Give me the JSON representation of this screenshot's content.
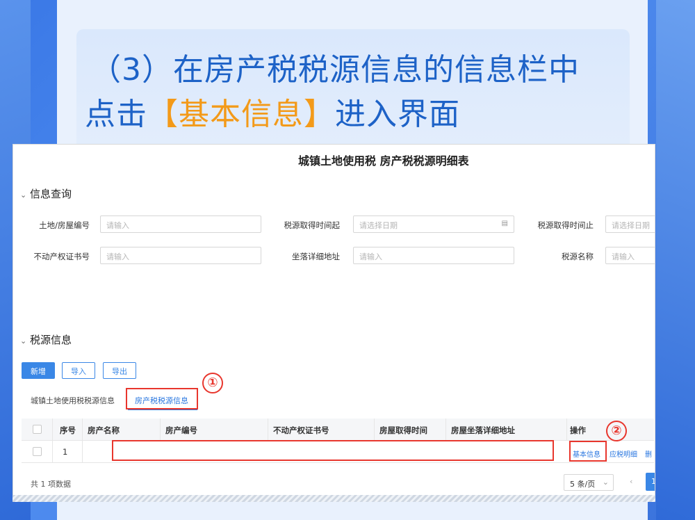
{
  "heading": {
    "line1": "（3）在房产税税源信息的信息栏中",
    "line2_pre": "点击",
    "line2_highlight": "【基本信息】",
    "line2_post": "进入界面"
  },
  "screenshot": {
    "title": "城镇土地使用税 房产税税源明细表",
    "query_section": {
      "title": "信息查询",
      "fields": [
        {
          "label": "土地/房屋编号",
          "placeholder": "请输入"
        },
        {
          "label": "税源取得时间起",
          "placeholder": "请选择日期"
        },
        {
          "label": "税源取得时间止",
          "placeholder": "请选择日期"
        },
        {
          "label": "不动产权证书号",
          "placeholder": "请输入"
        },
        {
          "label": "坐落详细地址",
          "placeholder": "请输入"
        },
        {
          "label": "税源名称",
          "placeholder": "请输入"
        }
      ]
    },
    "source_section": {
      "title": "税源信息",
      "buttons": {
        "add": "新增",
        "import": "导入",
        "export": "导出"
      },
      "tabs": [
        "城镇土地使用税税源信息",
        "房产税税源信息"
      ],
      "active_tab": 1,
      "table": {
        "columns": [
          "序号",
          "房产名称",
          "房产编号",
          "不动产权证书号",
          "房屋取得时间",
          "房屋坐落详细地址",
          "操作"
        ],
        "rows": [
          {
            "index": "1",
            "actions": [
              "基本信息",
              "应税明细",
              "删"
            ]
          }
        ]
      },
      "footer": {
        "total": "共 1 项数据",
        "page_size": "5 条/页",
        "prev": "‹",
        "current_page": "1"
      }
    },
    "annotations": {
      "step1": "①",
      "step2": "②"
    },
    "colors": {
      "accent": "#2a77e0",
      "annotation_red": "#e8362d",
      "highlight_orange": "#f39a19",
      "heading_blue": "#1d62c7"
    }
  }
}
